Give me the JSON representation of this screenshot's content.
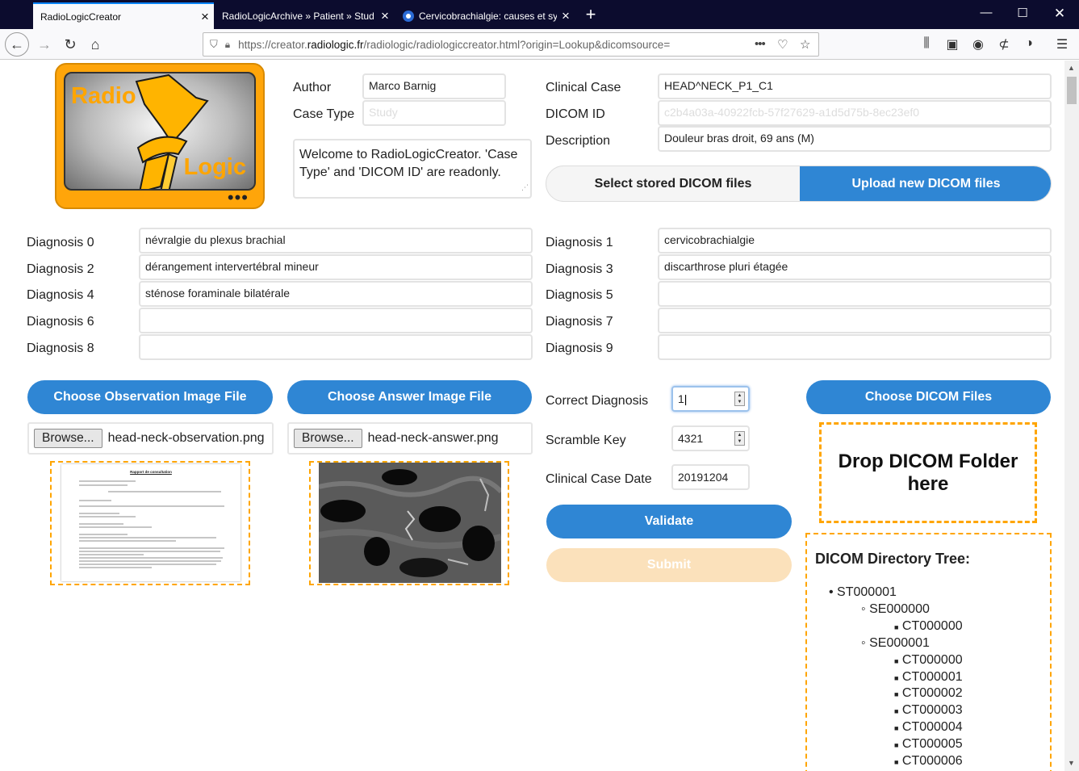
{
  "browser": {
    "tabs": [
      {
        "title": "RadioLogicCreator",
        "active": true
      },
      {
        "title": "RadioLogicArchive » Patient » Stud",
        "active": false
      },
      {
        "title": "Cervicobrachialgie: causes et sy",
        "active": false
      }
    ],
    "url_prefix": "https://creator.",
    "url_domain": "radiologic.fr",
    "url_path": "/radiologic/radiologiccreator.html?origin=Lookup&dicomsource=",
    "url_more": "•••"
  },
  "logo": {
    "line1": "Radio",
    "line2": "Logic",
    "dots": "•••"
  },
  "form": {
    "author_label": "Author",
    "author_value": "Marco Barnig",
    "case_type_label": "Case Type",
    "case_type_value": "Study",
    "welcome_text": "Welcome to RadioLogicCreator. 'Case Type' and 'DICOM ID' are readonly.",
    "clinical_case_label": "Clinical Case",
    "clinical_case_value": "HEAD^NECK_P1_C1",
    "dicom_id_label": "DICOM ID",
    "dicom_id_value": "c2b4a03a-40922fcb-57f27629-a1d5d75b-8ec23ef0",
    "description_label": "Description",
    "description_value": "Douleur bras droit, 69 ans (M)",
    "select_stored_label": "Select stored DICOM files",
    "upload_new_label": "Upload new DICOM files"
  },
  "diagnoses": [
    {
      "label": "Diagnosis 0",
      "value": "névralgie du plexus brachial"
    },
    {
      "label": "Diagnosis 1",
      "value": "cervicobrachialgie"
    },
    {
      "label": "Diagnosis 2",
      "value": "dérangement intervertébral mineur"
    },
    {
      "label": "Diagnosis 3",
      "value": "discarthrose pluri étagée"
    },
    {
      "label": "Diagnosis 4",
      "value": "sténose foraminale bilatérale"
    },
    {
      "label": "Diagnosis 5",
      "value": ""
    },
    {
      "label": "Diagnosis 6",
      "value": ""
    },
    {
      "label": "Diagnosis 7",
      "value": ""
    },
    {
      "label": "Diagnosis 8",
      "value": ""
    },
    {
      "label": "Diagnosis 9",
      "value": ""
    }
  ],
  "files": {
    "choose_observation_label": "Choose Observation Image File",
    "choose_answer_label": "Choose Answer Image File",
    "browse_label": "Browse...",
    "observation_file": "head-neck-observation.png",
    "answer_file": "head-neck-answer.png",
    "doc_heading": "Rapport de consultation"
  },
  "settings": {
    "correct_diagnosis_label": "Correct Diagnosis",
    "correct_diagnosis_value": "1",
    "scramble_key_label": "Scramble Key",
    "scramble_key_value": "4321",
    "clinical_case_date_label": "Clinical Case Date",
    "clinical_case_date_value": "20191204",
    "validate_label": "Validate",
    "submit_label": "Submit"
  },
  "dicom": {
    "choose_files_label": "Choose DICOM Files",
    "drop_line1": "Drop DICOM Folder",
    "drop_line2": "here",
    "tree_title": "DICOM Directory Tree:",
    "study": "ST000001",
    "series": [
      {
        "name": "SE000000",
        "images": [
          "CT000000"
        ]
      },
      {
        "name": "SE000001",
        "images": [
          "CT000000",
          "CT000001",
          "CT000002",
          "CT000003",
          "CT000004",
          "CT000005",
          "CT000006"
        ]
      }
    ]
  },
  "colors": {
    "accent": "#2f86d4",
    "orange": "#ffa500",
    "titlebar": "#0c0c2e"
  }
}
